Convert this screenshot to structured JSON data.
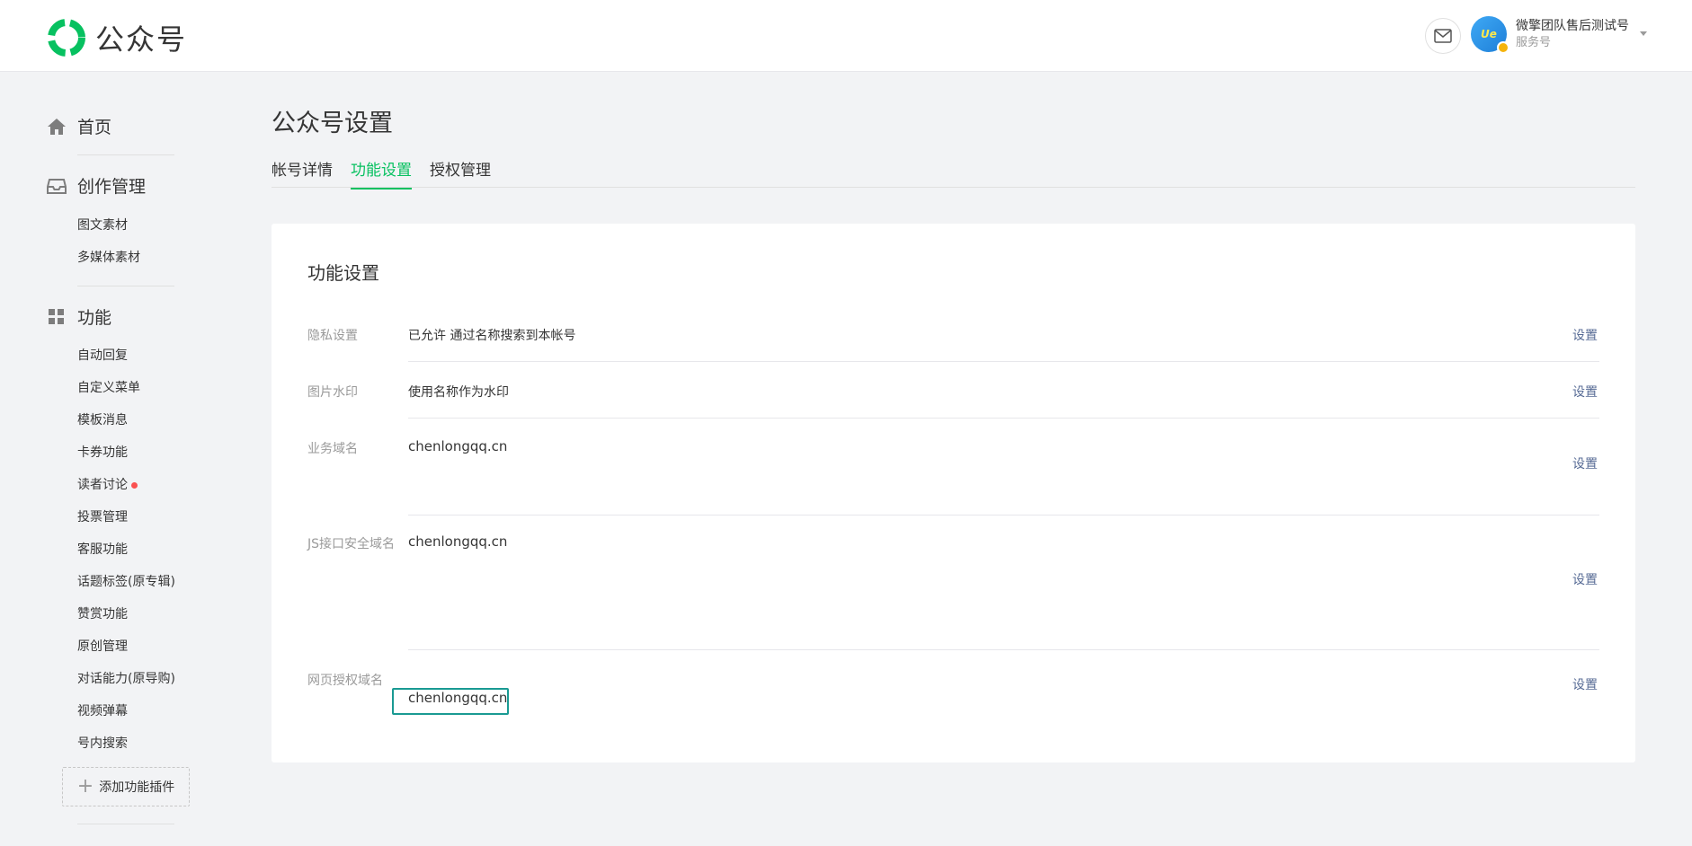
{
  "header": {
    "brand": "公众号",
    "account_name": "微擎团队售后测试号",
    "account_type": "服务号",
    "avatar_text": "Ue",
    "brand_color": "#07c160"
  },
  "sidebar": {
    "sections": [
      {
        "label": "首页",
        "icon": "home-icon"
      },
      {
        "label": "创作管理",
        "icon": "inbox-icon",
        "items": [
          "图文素材",
          "多媒体素材"
        ]
      },
      {
        "label": "功能",
        "icon": "grid-icon",
        "items": [
          "自动回复",
          "自定义菜单",
          "模板消息",
          "卡券功能",
          "读者讨论",
          "投票管理",
          "客服功能",
          "话题标签(原专辑)",
          "赞赏功能",
          "原创管理",
          "对话能力(原导购)",
          "视频弹幕",
          "号内搜索"
        ]
      }
    ],
    "add_plugin_label": "添加功能插件"
  },
  "main": {
    "title": "公众号设置",
    "tabs": [
      {
        "label": "帐号详情",
        "active": false
      },
      {
        "label": "功能设置",
        "active": true
      },
      {
        "label": "授权管理",
        "active": false
      }
    ],
    "card": {
      "title": "功能设置",
      "rows": [
        {
          "label": "隐私设置",
          "value": "已允许 通过名称搜索到本帐号",
          "action": "设置"
        },
        {
          "label": "图片水印",
          "value": "使用名称作为水印",
          "action": "设置"
        },
        {
          "label": "业务域名",
          "value": "chenlongqq.cn",
          "action": "设置"
        },
        {
          "label": "JS接口安全域名",
          "value": "chenlongqq.cn",
          "action": "设置"
        },
        {
          "label": "网页授权域名",
          "value": "chenlongqq.cn",
          "action": "设置"
        }
      ]
    }
  }
}
